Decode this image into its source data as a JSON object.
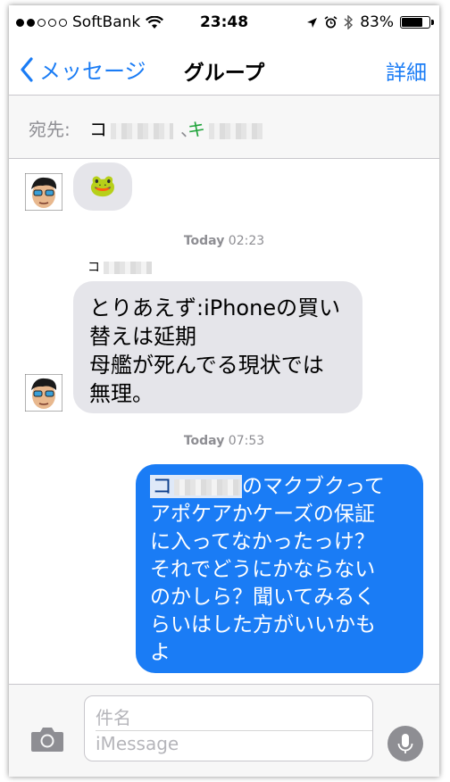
{
  "status_bar": {
    "carrier": "SoftBank",
    "signal_bars_filled": 2,
    "signal_bars_total": 5,
    "time": "23:48",
    "battery": "83%",
    "battery_level": 0.83
  },
  "nav": {
    "back_label": "メッセージ",
    "title": "グループ",
    "details_label": "詳細"
  },
  "recipients": {
    "label": "宛先:",
    "first": "コ",
    "separator": "、",
    "second": "キ"
  },
  "messages": [
    {
      "type": "incoming",
      "text": "🐸"
    },
    {
      "type": "timestamp",
      "day": "Today",
      "time": "02:23"
    },
    {
      "type": "sender",
      "name": "コ"
    },
    {
      "type": "incoming",
      "lines": [
        "とりあえず:iPhoneの買い",
        "替えは延期",
        "母艦が死んでる現状では",
        "無理。"
      ]
    },
    {
      "type": "timestamp",
      "day": "Today",
      "time": "07:53"
    },
    {
      "type": "outgoing",
      "mention": "コ",
      "lines": [
        "のマクブクって",
        "アポケアかケーズの保証",
        "に入ってなかったっけ？",
        "それでどうにかならない",
        "のかしら？聞いてみるく",
        "らいはした方がいいかも",
        "よ"
      ]
    }
  ],
  "input": {
    "subject_placeholder": "件名",
    "message_placeholder": "iMessage"
  },
  "colors": {
    "accent": "#1a7cf5",
    "incoming_bubble": "#e5e5ea",
    "outgoing_bubble": "#1a7cf5",
    "recipient_highlight": "#1fa33a"
  }
}
